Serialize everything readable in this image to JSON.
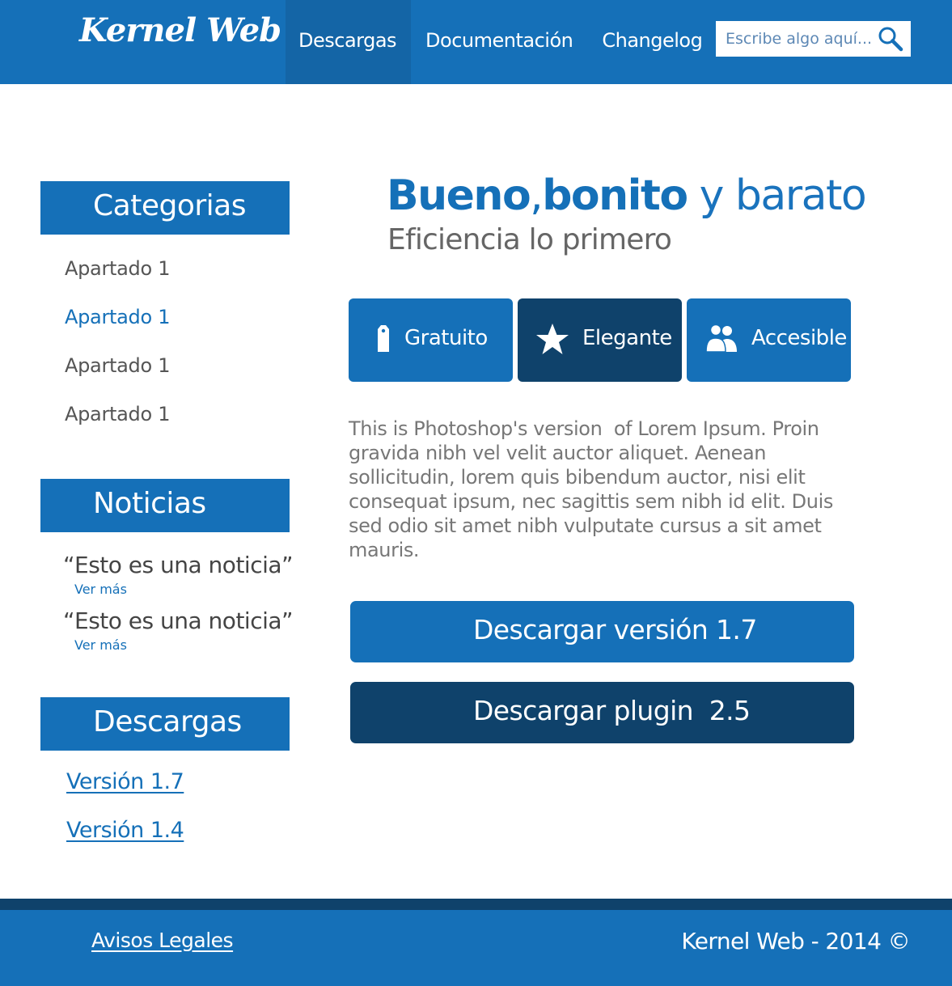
{
  "header": {
    "logo": "Kernel Web",
    "nav": [
      {
        "label": "Descargas",
        "active": true
      },
      {
        "label": "Documentación",
        "active": false
      },
      {
        "label": "Changelog",
        "active": false
      }
    ],
    "search": {
      "placeholder": "Escribe algo aquí...",
      "icon": "search-icon"
    }
  },
  "sidebar": {
    "categories": {
      "title": "Categorias",
      "items": [
        "Apartado 1",
        "Apartado 1",
        "Apartado 1",
        "Apartado 1"
      ]
    },
    "news": {
      "title": "Noticias",
      "items": [
        {
          "title": "“Esto es una noticia”",
          "more": "Ver más"
        },
        {
          "title": "“Esto es una noticia”",
          "more": "Ver más"
        }
      ]
    },
    "downloads": {
      "title": "Descargas",
      "links": [
        "Versión 1.7",
        "Versión 1.4"
      ]
    }
  },
  "main": {
    "hero": {
      "bold1": "Bueno",
      "comma": ",",
      "bold2": "bonito",
      "thin": " y barato",
      "subtitle": "Eficiencia lo primero"
    },
    "features": [
      {
        "label": "Gratuito",
        "icon": "tag-icon"
      },
      {
        "label": "Elegante",
        "icon": "star-icon"
      },
      {
        "label": "Accesible",
        "icon": "users-icon"
      }
    ],
    "body": "This is Photoshop's version  of Lorem Ipsum. Proin gravida nibh vel velit auctor aliquet. Aenean sollicitudin, lorem quis bibendum auctor, nisi elit consequat ipsum, nec sagittis sem nibh id elit. Duis sed odio sit amet nibh vulputate cursus a sit amet mauris.",
    "buttons": [
      "Descargar versión 1.7",
      "Descargar plugin  2.5"
    ]
  },
  "footer": {
    "legal": "Avisos Legales",
    "copyright": "Kernel Web - 2014 ©"
  },
  "colors": {
    "primary": "#1570b8",
    "dark": "#0f426b",
    "active_nav": "#1465a6"
  }
}
